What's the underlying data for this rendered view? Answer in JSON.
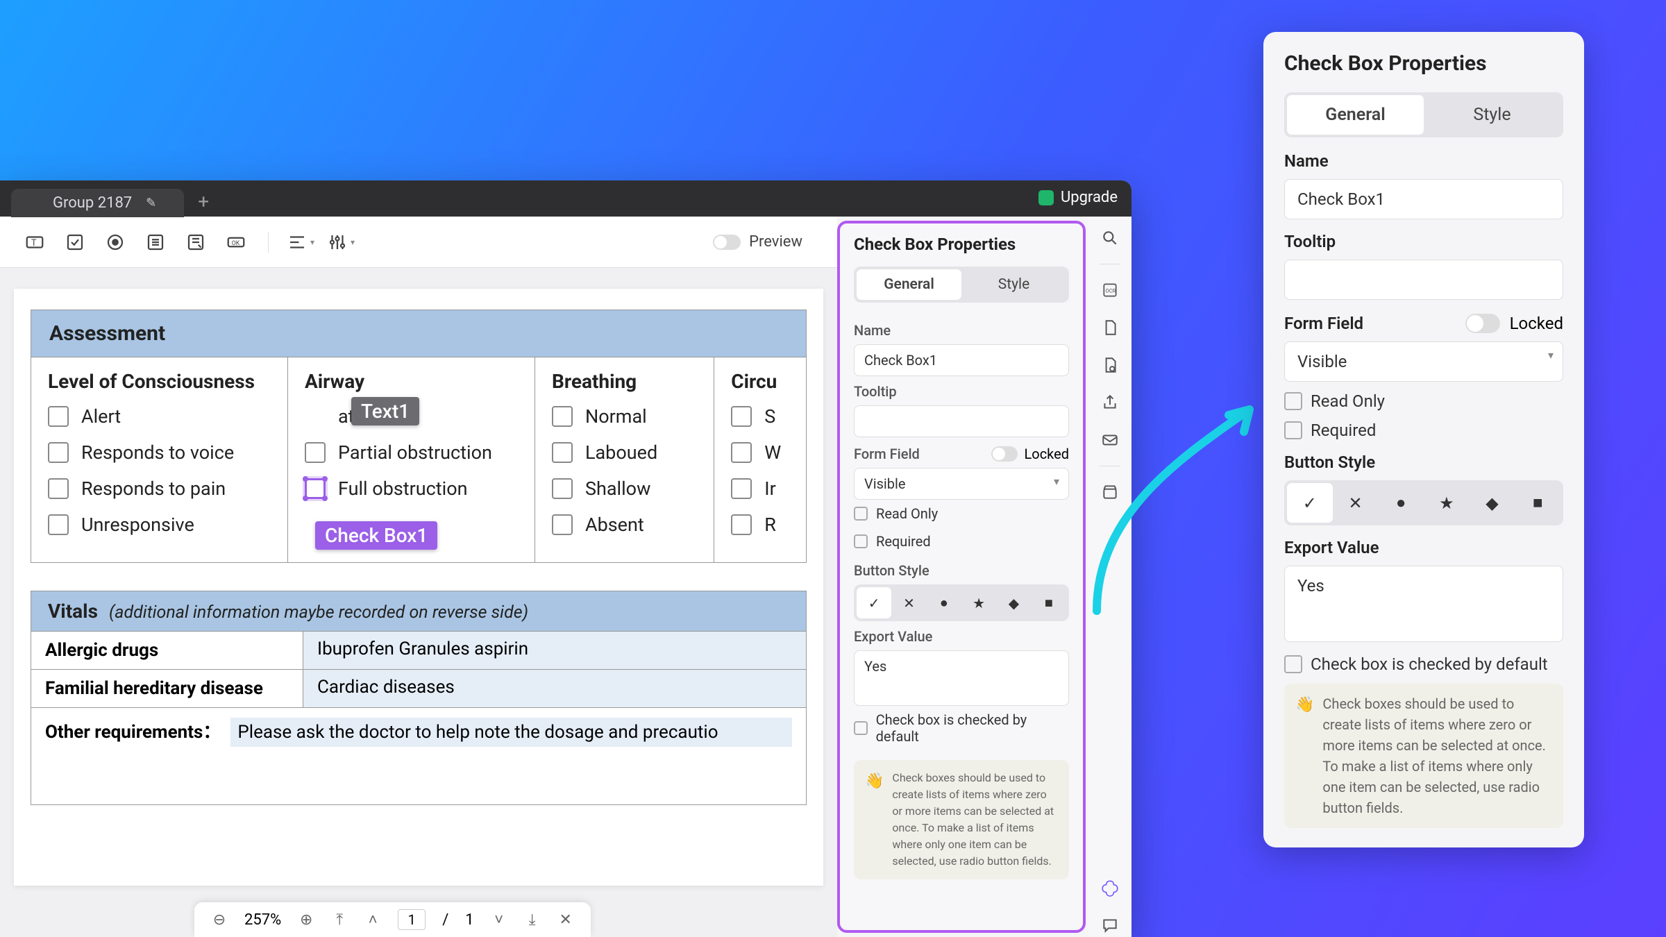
{
  "tab": {
    "title": "Group 2187"
  },
  "upgrade": "Upgrade",
  "toolbar": {
    "preview": "Preview"
  },
  "assessment": {
    "title": "Assessment",
    "columns": {
      "loc": {
        "title": "Level of Consciousness",
        "items": [
          "Alert",
          "Responds to voice",
          "Responds to pain",
          "Unresponsive"
        ]
      },
      "airway": {
        "title": "Airway",
        "items": [
          "atient",
          "Partial obstruction",
          "Full obstruction"
        ]
      },
      "breathing": {
        "title": "Breathing",
        "items": [
          "Normal",
          "Laboued",
          "Shallow",
          "Absent"
        ]
      },
      "circulation": {
        "title": "Circu",
        "items": [
          "S",
          "W",
          "Ir",
          "R"
        ]
      }
    },
    "tags": {
      "text1": "Text1",
      "checkbox1": "Check Box1"
    }
  },
  "vitals": {
    "title": "Vitals",
    "subtitle": "(additional information maybe recorded on reverse side)",
    "rows": {
      "allergic": {
        "label": "Allergic drugs",
        "value": "Ibuprofen Granules  aspirin"
      },
      "familial": {
        "label": "Familial hereditary disease",
        "value": "Cardiac diseases"
      },
      "other": {
        "label": "Other requirements：",
        "value": "Please ask the doctor to help note the dosage and precautio"
      }
    }
  },
  "pager": {
    "zoom": "257%",
    "page": "1",
    "total": "1"
  },
  "props": {
    "title": "Check Box Properties",
    "tabs": {
      "general": "General",
      "style": "Style"
    },
    "name_label": "Name",
    "name_value": "Check Box1",
    "tooltip_label": "Tooltip",
    "tooltip_value": "",
    "formfield_label": "Form Field",
    "locked_label": "Locked",
    "visibility": "Visible",
    "readonly": "Read Only",
    "required": "Required",
    "buttonstyle_label": "Button Style",
    "exportvalue_label": "Export Value",
    "exportvalue": "Yes",
    "checked_default": "Check box is checked by default",
    "info": "Check boxes should be used to create lists of items where zero or more items can be selected at once. To make a list of items where only one item can be selected, use radio button fields."
  }
}
